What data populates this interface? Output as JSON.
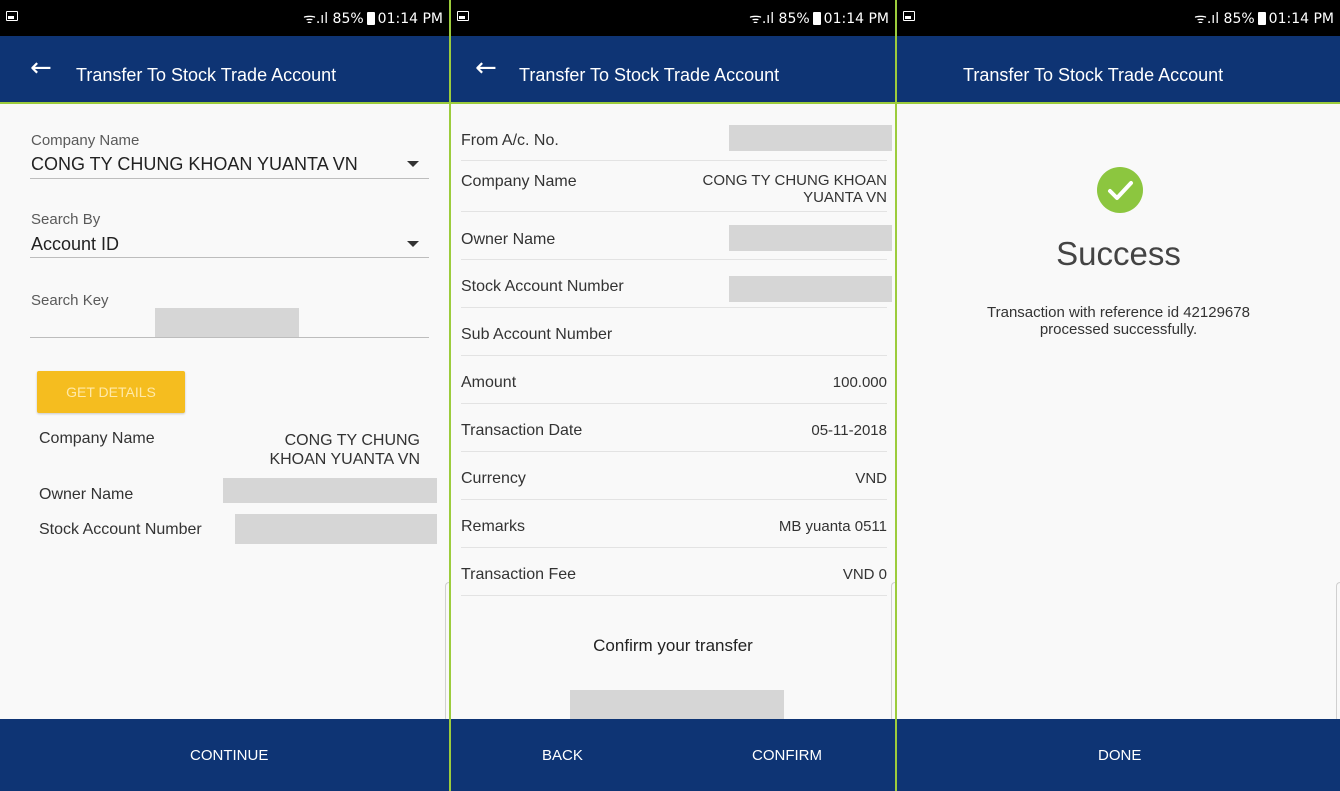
{
  "status_bar": {
    "signal_text": "85%",
    "time": "01:14 PM"
  },
  "screen1": {
    "title": "Transfer To Stock Trade Account",
    "back_icon": "arrow-left",
    "company_name_label": "Company Name",
    "company_name_value": "CONG TY CHUNG KHOAN YUANTA VN",
    "search_by_label": "Search By",
    "search_by_value": "Account ID",
    "search_key_label": "Search Key",
    "get_details_label": "GET DETAILS",
    "details": {
      "company_name_label": "Company Name",
      "company_name_value": "CONG TY CHUNG KHOAN YUANTA VN",
      "owner_name_label": "Owner Name",
      "stock_account_label": "Stock Account Number"
    },
    "continue_label": "CONTINUE"
  },
  "screen2": {
    "title": "Transfer To Stock Trade Account",
    "back_icon": "arrow-left",
    "rows": {
      "from_ac_label": "From A/c. No.",
      "company_name_label": "Company Name",
      "company_name_value": "CONG TY CHUNG KHOAN YUANTA VN",
      "owner_name_label": "Owner Name",
      "stock_account_label": "Stock Account Number",
      "sub_account_label": "Sub Account Number",
      "amount_label": "Amount",
      "amount_value": "100.000",
      "transaction_date_label": "Transaction Date",
      "transaction_date_value": "05-11-2018",
      "currency_label": "Currency",
      "currency_value": "VND",
      "remarks_label": "Remarks",
      "remarks_value": "MB yuanta 0511",
      "transaction_fee_label": "Transaction Fee",
      "transaction_fee_value": "VND 0"
    },
    "confirm_prompt": "Confirm your transfer",
    "back_label": "BACK",
    "confirm_label": "CONFIRM"
  },
  "screen3": {
    "title": "Transfer To Stock Trade Account",
    "success_icon": "check-circle",
    "success_title": "Success",
    "message": "Transaction with reference id 42129678 processed successfully.",
    "done_label": "DONE"
  },
  "colors": {
    "app_bar": "#0e3474",
    "accent_green": "#9ccc3c",
    "button_yellow": "#f5bd1f",
    "success_green": "#8cc63f"
  }
}
